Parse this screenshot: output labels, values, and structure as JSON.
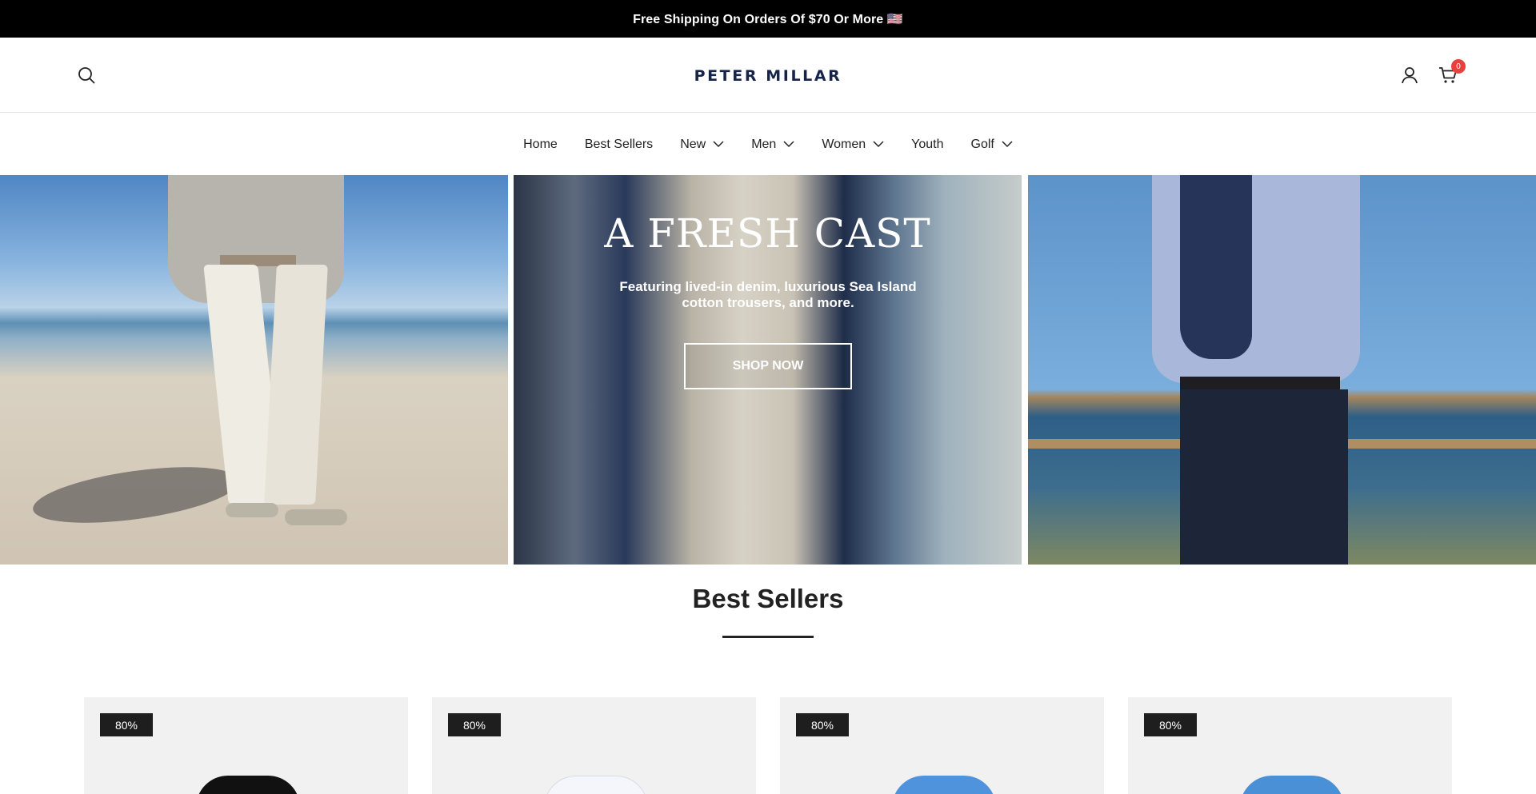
{
  "announcement": {
    "text": "Free Shipping On Orders Of $70 Or More 🇺🇸"
  },
  "header": {
    "logo_text": "PETER MILLAR",
    "cart_count": "0"
  },
  "nav": {
    "items": [
      {
        "label": "Home",
        "has_dropdown": false
      },
      {
        "label": "Best Sellers",
        "has_dropdown": false
      },
      {
        "label": "New",
        "has_dropdown": true
      },
      {
        "label": "Men",
        "has_dropdown": true
      },
      {
        "label": "Women",
        "has_dropdown": true
      },
      {
        "label": "Youth",
        "has_dropdown": false
      },
      {
        "label": "Golf",
        "has_dropdown": true
      }
    ]
  },
  "hero": {
    "title": "A FRESH CAST",
    "subtitle": "Featuring lived-in denim, luxurious Sea Island cotton trousers, and more.",
    "cta_label": "SHOP NOW"
  },
  "best_sellers": {
    "title": "Best Sellers",
    "products": [
      {
        "badge": "80%"
      },
      {
        "badge": "80%"
      },
      {
        "badge": "80%"
      },
      {
        "badge": "80%"
      }
    ]
  },
  "colors": {
    "announcement_bg": "#000000",
    "logo_navy": "#17244a",
    "cart_badge": "#e8413c",
    "badge_bg": "#1e1e1e"
  }
}
